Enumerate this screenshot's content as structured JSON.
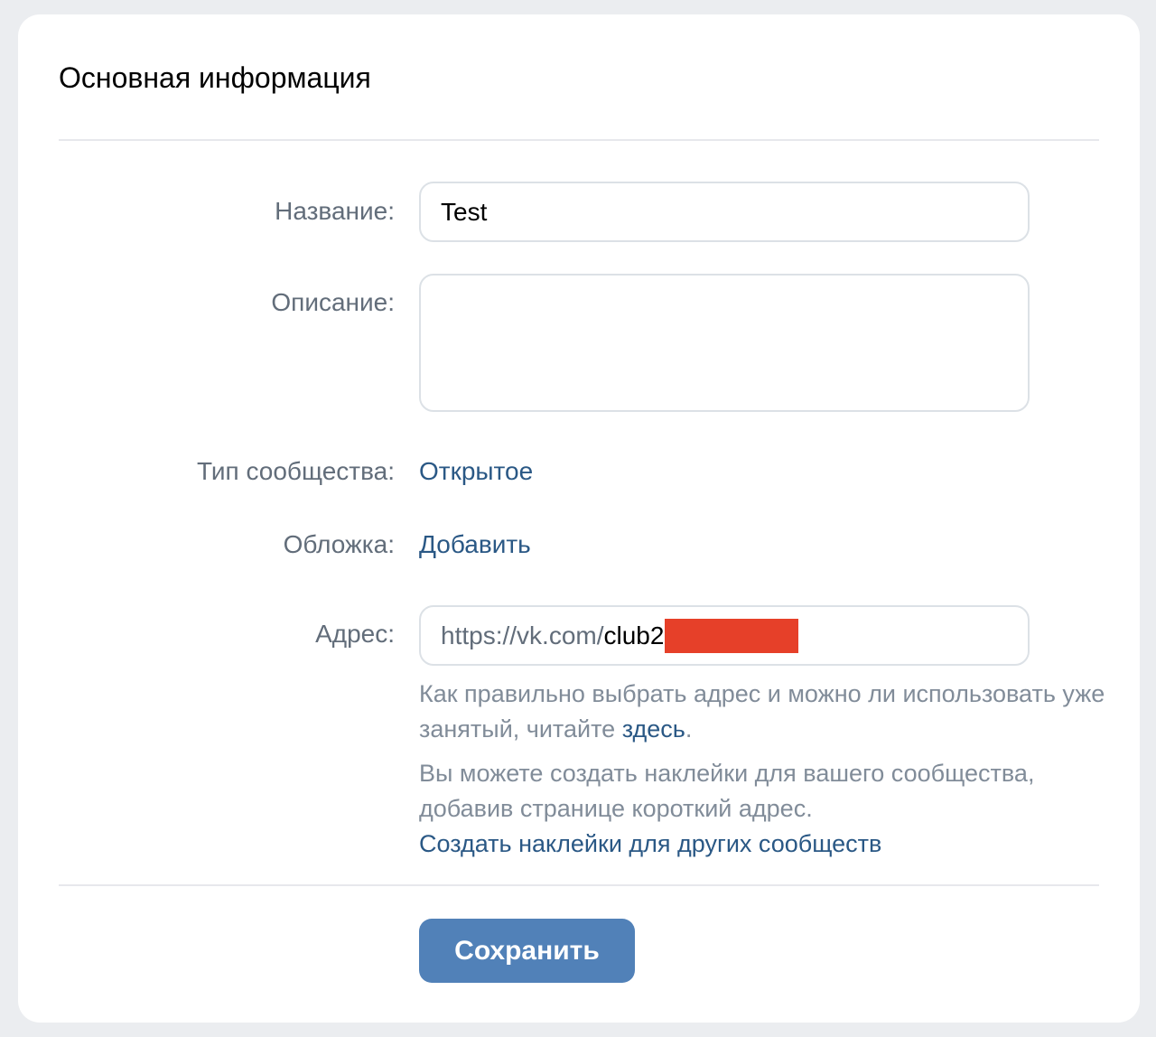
{
  "section": {
    "title": "Основная информация"
  },
  "form": {
    "name": {
      "label": "Название:",
      "value": "Test"
    },
    "description": {
      "label": "Описание:",
      "value": ""
    },
    "community_type": {
      "label": "Тип сообщества:",
      "value": "Открытое"
    },
    "cover": {
      "label": "Обложка:",
      "action": "Добавить"
    },
    "address": {
      "label": "Адрес:",
      "prefix": "https://vk.com/",
      "value": "club2"
    }
  },
  "help": {
    "address_text": "Как правильно выбрать адрес и можно ли использовать уже занятый, читайте ",
    "address_link": "здесь",
    "address_end": ".",
    "stickers_text": "Вы можете создать наклейки для вашего сообщества, добавив странице короткий адрес.",
    "stickers_link": "Создать наклейки для других сообществ"
  },
  "actions": {
    "save_label": "Сохранить"
  },
  "colors": {
    "link": "#2a5885",
    "button": "#5181b8",
    "redaction": "#e64029"
  }
}
